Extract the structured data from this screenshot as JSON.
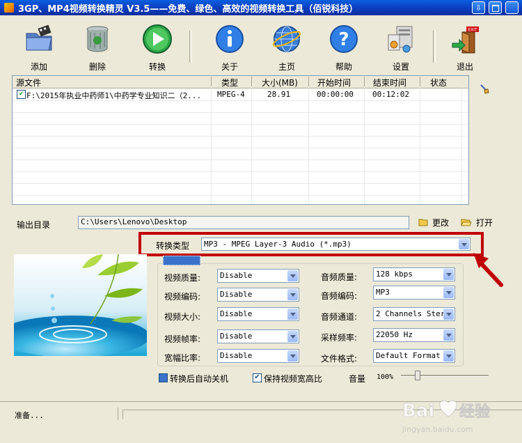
{
  "window": {
    "title": "3GP、MP4视频转换精灵 V3.5——免费、绿色、高效的视频转换工具（佰锐科技）",
    "controls": [
      "minimize-icon",
      "restore-icon",
      "close-icon"
    ]
  },
  "toolbar": {
    "add": "添加",
    "delete": "删除",
    "convert": "转换",
    "about": "关于",
    "home": "主页",
    "help": "帮助",
    "settings": "设置",
    "exit": "退出"
  },
  "file_list": {
    "columns": [
      "源文件",
      "类型",
      "大小(MB)",
      "开始时间",
      "结束时间",
      "状态"
    ],
    "rows": [
      {
        "checked": true,
        "source": "F:\\2015年执业中药师1\\中药学专业知识二（2...",
        "type": "MPEG-4",
        "size": "28.91",
        "start": "00:00:00",
        "end": "00:12:02",
        "status": ""
      }
    ]
  },
  "output": {
    "label": "输出目录",
    "path": "C:\\Users\\Lenovo\\Desktop",
    "change_label": "更改",
    "open_label": "打开"
  },
  "convert_type": {
    "label": "转换类型",
    "value": "MP3 - MPEG Layer-3 Audio (*.mp3)"
  },
  "params": {
    "video_quality": {
      "label": "视频质量:",
      "value": "Disable"
    },
    "video_codec": {
      "label": "视频编码:",
      "value": "Disable"
    },
    "video_size": {
      "label": "视频大小:",
      "value": "Disable"
    },
    "frame_rate": {
      "label": "视频帧率:",
      "value": "Disable"
    },
    "aspect_ratio": {
      "label": "宽幅比率:",
      "value": "Disable"
    },
    "audio_quality": {
      "label": "音频质量:",
      "value": "128 kbps"
    },
    "audio_codec": {
      "label": "音频编码:",
      "value": "MP3"
    },
    "audio_channels": {
      "label": "音频通道:",
      "value": "2 Channels Stere"
    },
    "sample_rate": {
      "label": "采样频率:",
      "value": "22050 Hz"
    },
    "file_format": {
      "label": "文件格式:",
      "value": "Default Format"
    }
  },
  "options": {
    "auto_shutdown": {
      "label": "转换后自动关机",
      "checked": false
    },
    "keep_aspect": {
      "label": "保持视频宽高比",
      "checked": true
    },
    "volume_label": "音量",
    "volume_value": "100%",
    "volume_level": 1.0
  },
  "status": {
    "text": "准备..."
  },
  "colors": {
    "titlebar": "#0b3fc0",
    "highlight_box": "#c00000",
    "client_bg": "#ece9d8"
  }
}
